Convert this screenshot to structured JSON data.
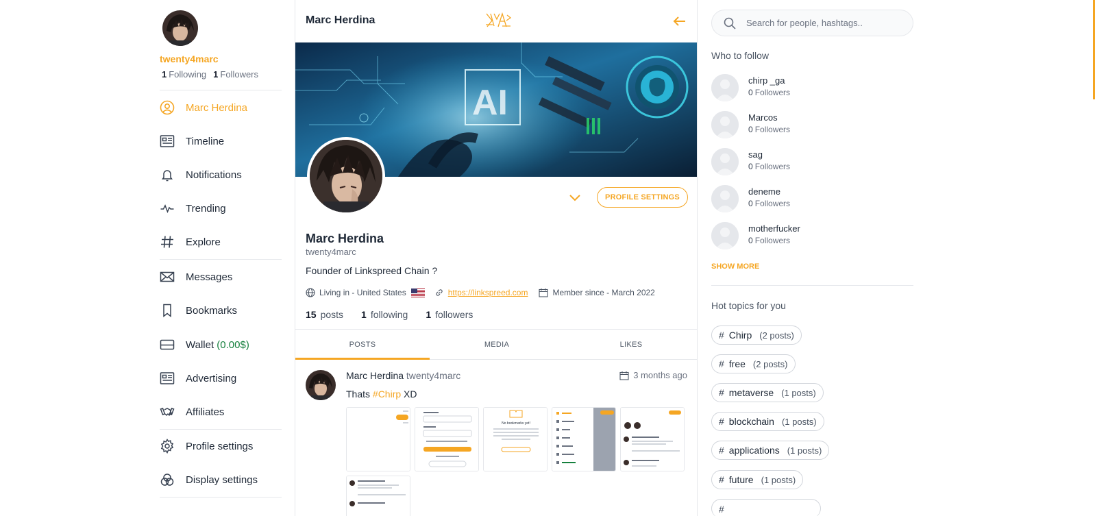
{
  "colors": {
    "accent": "#f5a623",
    "wallet": "#15803d",
    "text": "#1f2937",
    "muted": "#6b7280"
  },
  "me": {
    "handle": "twenty4marc",
    "following_count": "1",
    "following_label": "Following",
    "followers_count": "1",
    "followers_label": "Followers"
  },
  "sidebar": {
    "items": [
      {
        "label": "Marc Herdina",
        "icon": "user-circle-icon"
      },
      {
        "label": "Timeline",
        "icon": "timeline-icon"
      },
      {
        "label": "Notifications",
        "icon": "bell-icon"
      },
      {
        "label": "Trending",
        "icon": "activity-icon"
      },
      {
        "label": "Explore",
        "icon": "hash-icon"
      },
      {
        "label": "Messages",
        "icon": "envelope-icon"
      },
      {
        "label": "Bookmarks",
        "icon": "bookmark-icon"
      },
      {
        "label": "Wallet",
        "amount": "(0.00$)",
        "icon": "wallet-icon"
      },
      {
        "label": "Advertising",
        "icon": "ad-card-icon"
      },
      {
        "label": "Affiliates",
        "icon": "handshake-icon"
      },
      {
        "label": "Profile settings",
        "icon": "gear-icon"
      },
      {
        "label": "Display settings",
        "icon": "palette-icon"
      }
    ]
  },
  "header": {
    "title": "Marc Herdina"
  },
  "profile": {
    "settings_button": "PROFILE SETTINGS",
    "name": "Marc Herdina",
    "handle": "twenty4marc",
    "bio": "Founder of Linkspreed Chain ?",
    "location": "Living in - United States",
    "website": "https://linkspreed.com",
    "member_since": "Member since - March 2022",
    "posts_count": "15",
    "posts_label": "posts",
    "following_count": "1",
    "following_label": "following",
    "followers_count": "1",
    "followers_label": "followers"
  },
  "tabs": [
    {
      "label": "POSTS"
    },
    {
      "label": "MEDIA"
    },
    {
      "label": "LIKES"
    }
  ],
  "post": {
    "author": "Marc Herdina",
    "handle": "twenty4marc",
    "time": "3 months ago",
    "text_before": "Thats ",
    "hashtag": "#Chirp",
    "text_after": " XD",
    "thumb1_heading": "No bookmarks yet!"
  },
  "search": {
    "placeholder": "Search for people, hashtags.."
  },
  "who_to_follow": {
    "title": "Who to follow",
    "followers_label": "Followers",
    "users": [
      {
        "name": "chirp _ga",
        "followers": "0"
      },
      {
        "name": "Marcos",
        "followers": "0"
      },
      {
        "name": "sag",
        "followers": "0"
      },
      {
        "name": "deneme",
        "followers": "0"
      },
      {
        "name": "motherfucker",
        "followers": "0"
      }
    ],
    "show_more": "SHOW MORE"
  },
  "hot_topics": {
    "title": "Hot topics for you",
    "topics": [
      {
        "tag": "Chirp",
        "count": "(2 posts)"
      },
      {
        "tag": "free",
        "count": "(2 posts)"
      },
      {
        "tag": "metaverse",
        "count": "(1 posts)"
      },
      {
        "tag": "blockchain",
        "count": "(1 posts)"
      },
      {
        "tag": "applications",
        "count": "(1 posts)"
      },
      {
        "tag": "future",
        "count": "(1 posts)"
      }
    ]
  }
}
